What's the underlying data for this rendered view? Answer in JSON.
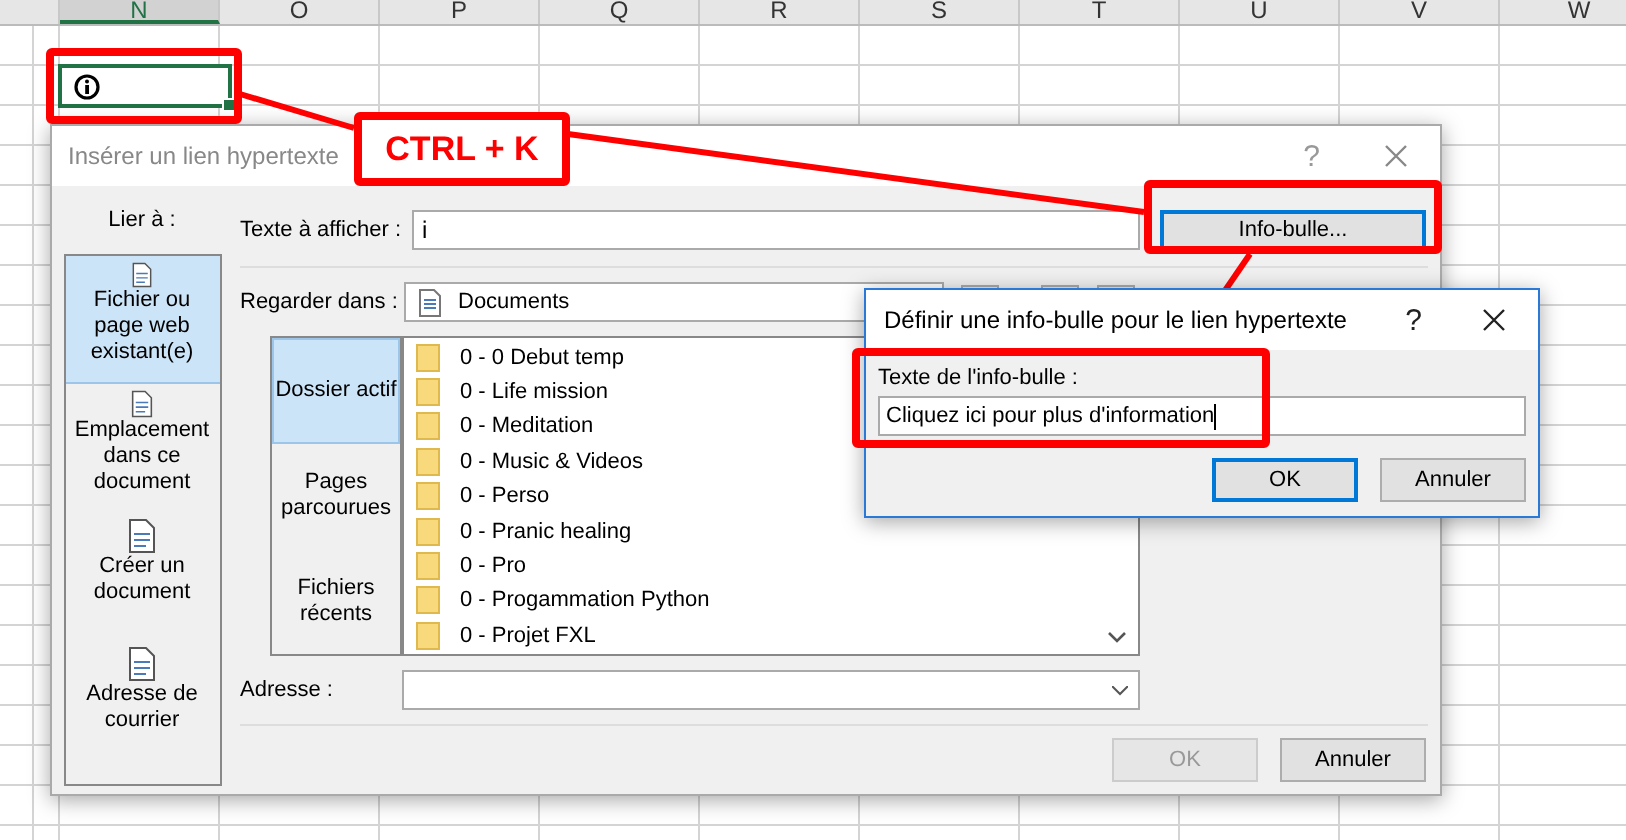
{
  "spreadsheet": {
    "columns": [
      {
        "label": "N",
        "selected": true
      },
      {
        "label": "O",
        "selected": false
      },
      {
        "label": "P",
        "selected": false
      },
      {
        "label": "Q",
        "selected": false
      },
      {
        "label": "R",
        "selected": false
      },
      {
        "label": "S",
        "selected": false
      },
      {
        "label": "T",
        "selected": false
      },
      {
        "label": "U",
        "selected": false
      },
      {
        "label": "V",
        "selected": false
      },
      {
        "label": "W",
        "selected": false
      }
    ]
  },
  "annotation": {
    "shortcut": "CTRL + K"
  },
  "hyperlink_dialog": {
    "title": "Insérer un lien hypertexte",
    "help": "?",
    "link_to_label": "Lier à :",
    "link_targets": [
      {
        "label": "Fichier ou page web existant(e)",
        "selected": true
      },
      {
        "label": "Emplacement dans ce document",
        "selected": false
      },
      {
        "label": "Créer un document",
        "selected": false
      },
      {
        "label": "Adresse de courrier",
        "selected": false
      }
    ],
    "display_text": {
      "label": "Texte à afficher :",
      "value": "i"
    },
    "tooltip_button": "Info-bulle...",
    "look_in": {
      "label": "Regarder dans :",
      "value": "Documents"
    },
    "browse_tabs": [
      {
        "label": "Dossier actif",
        "selected": true
      },
      {
        "label": "Pages parcourues",
        "selected": false
      },
      {
        "label": "Fichiers récents",
        "selected": false
      }
    ],
    "files": [
      "0 - 0 Debut temp",
      "0 - Life mission",
      "0 - Meditation",
      "0 - Music & Videos",
      "0 - Perso",
      "0 - Pranic healing",
      "0 - Pro",
      "0 - Progammation Python",
      "0 - Projet FXL"
    ],
    "address": {
      "label": "Adresse :"
    },
    "buttons": [
      {
        "label": "OK",
        "disabled": true
      },
      {
        "label": "Annuler",
        "disabled": false
      }
    ]
  },
  "tooltip_dialog": {
    "title": "Définir une info-bulle pour le lien hypertexte",
    "help": "?",
    "field": {
      "label": "Texte de l'info-bulle :",
      "value": "Cliquez ici pour plus d'information"
    },
    "buttons": [
      {
        "label": "OK",
        "default": true
      },
      {
        "label": "Annuler",
        "default": false
      }
    ]
  }
}
